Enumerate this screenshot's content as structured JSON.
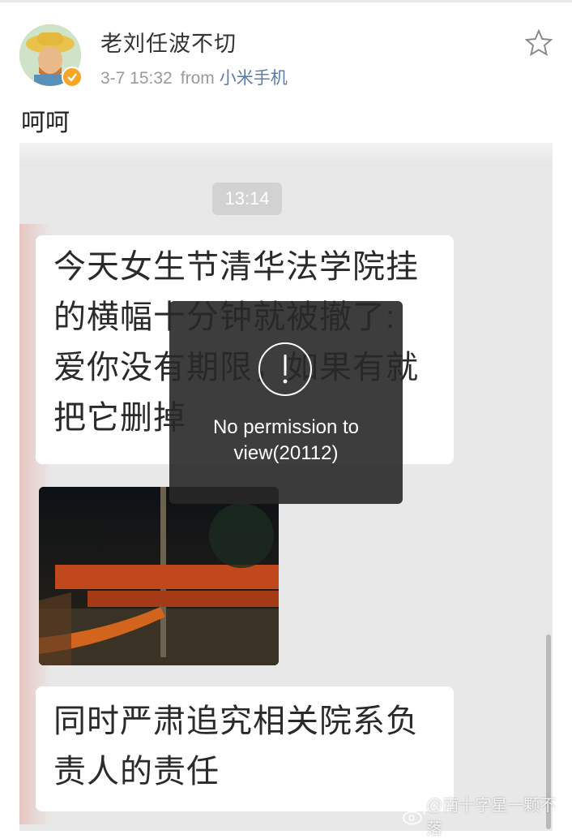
{
  "post": {
    "username": "老刘任波不切",
    "timestamp": "3-7 15:32",
    "from_label": "from",
    "device": "小米手机",
    "text": "呵呵"
  },
  "screenshot": {
    "time": "13:14",
    "message1_lines": [
      "今天女生节清华法学院挂",
      "的横幅十分钟就被撤了:",
      "爱你没有期限，如果有就",
      "把它删掉"
    ],
    "message2_lines": [
      "同时严肃追究相关院系负",
      "责人的责任"
    ]
  },
  "toast": {
    "icon": "exclamation-circle-icon",
    "message": "No permission to view(20112)"
  },
  "watermark": {
    "icon": "weibo-icon",
    "text": "@南十字星一颗不落"
  },
  "colors": {
    "device_link": "#5b7da8",
    "verified_badge": "#f5a623",
    "toast_background": "#282828"
  }
}
